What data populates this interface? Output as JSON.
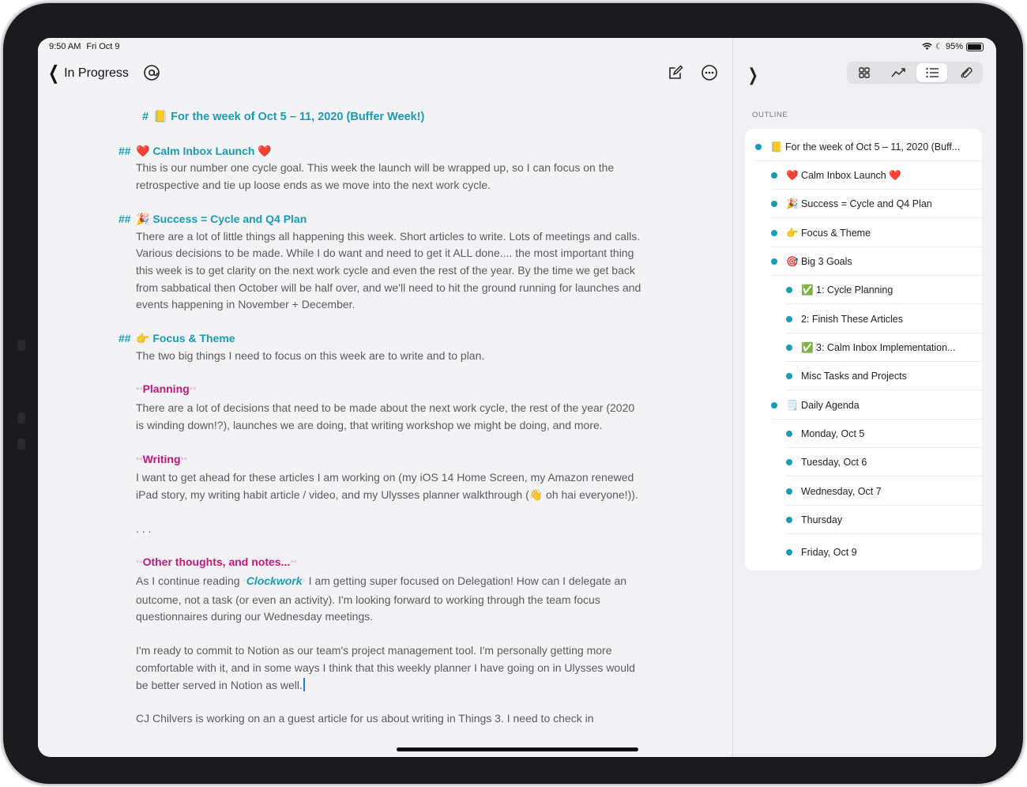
{
  "status": {
    "time": "9:50 AM",
    "date": "Fri Oct 9",
    "battery": "95%"
  },
  "nav": {
    "back_label": "In Progress"
  },
  "icons": {
    "back": "chevron-left-icon",
    "at": "at-sign-icon",
    "compose": "compose-icon",
    "more": "ellipsis-circle-icon",
    "collapse": "chevron-right-icon",
    "attachment": "paperclip-icon"
  },
  "colors": {
    "heading": "#1a9bb5",
    "strong": "#c2187a",
    "body": "#5b5b5b",
    "accent": "#1a9bb5"
  },
  "document": {
    "title_mark": "#",
    "title": "📒 For the week of Oct 5 – 11, 2020 (Buffer Week!)",
    "h2_mark": "##",
    "sections": [
      {
        "heading": "❤️ Calm Inbox Launch ❤️",
        "text": "This is our number one cycle goal. This week the launch will be wrapped up, so I can focus on the retrospective and tie up loose ends as we move into the next work cycle."
      },
      {
        "heading": "🎉 Success = Cycle and Q4 Plan",
        "text": "There are a lot of little things all happening this week. Short articles to write. Lots of meetings and calls. Various decisions to be made. While I do want and need to get it ALL done.... the most important thing this week is to get clarity on the next work cycle and even the rest of the year. By the time we get back from sabbatical then October will be half over, and we'll need to hit the ground running for launches and events happening in November + December."
      },
      {
        "heading": "👉 Focus & Theme",
        "text": "The two big things I need to focus on this week are to write and to plan."
      }
    ],
    "strong_mark": "**",
    "planning_label": "Planning",
    "planning_text": "There are a lot of decisions that need to be made about the next work cycle, the rest of the year (2020 is winding down!?), launches we are doing, that writing workshop we might be doing, and more.",
    "writing_label": "Writing",
    "writing_text": "I want to get ahead for these articles I am working on (my iOS 14 Home Screen, my Amazon renewed iPad story, my writing habit article / video, and my Ulysses planner walkthrough (👋 oh hai everyone!)).",
    "separator": ". . .",
    "other_label": "Other thoughts, and notes...",
    "em_mark": "*",
    "other_pre": "As I continue reading ",
    "other_em": "Clockwork",
    "other_post": " I am getting super focused on Delegation! How can I delegate an outcome, not a task (or even an activity). I'm looking forward to working through the team focus questionnaires during our Wednesday meetings.",
    "notion_text": "I'm ready to commit to Notion as our team's project management tool. I'm personally getting more comfortable with it, and in some ways I think that this weekly planner I have going on in Ulysses would be better served in Notion as well.",
    "last_text": "CJ Chilvers is working on an a guest article for us about writing in Things 3. I need to check in"
  },
  "sidebar": {
    "outline_title": "OUTLINE",
    "items": [
      {
        "label": "📒 For the week of Oct 5 – 11, 2020 (Buff..."
      },
      {
        "label": "❤️ Calm Inbox Launch ❤️"
      },
      {
        "label": "🎉 Success = Cycle and Q4 Plan"
      },
      {
        "label": "👉 Focus & Theme"
      },
      {
        "label": "🎯 Big 3 Goals"
      },
      {
        "label": "✅ 1: Cycle Planning"
      },
      {
        "label": "2: Finish These Articles"
      },
      {
        "label": "✅ 3: Calm Inbox Implementation..."
      },
      {
        "label": "Misc Tasks and Projects"
      },
      {
        "label": "🗒️ Daily Agenda"
      },
      {
        "label": "Monday, Oct 5"
      },
      {
        "label": "Tuesday, Oct 6"
      },
      {
        "label": "Wednesday, Oct 7"
      },
      {
        "label": "Thursday"
      },
      {
        "label": "Friday, Oct 9"
      }
    ]
  }
}
